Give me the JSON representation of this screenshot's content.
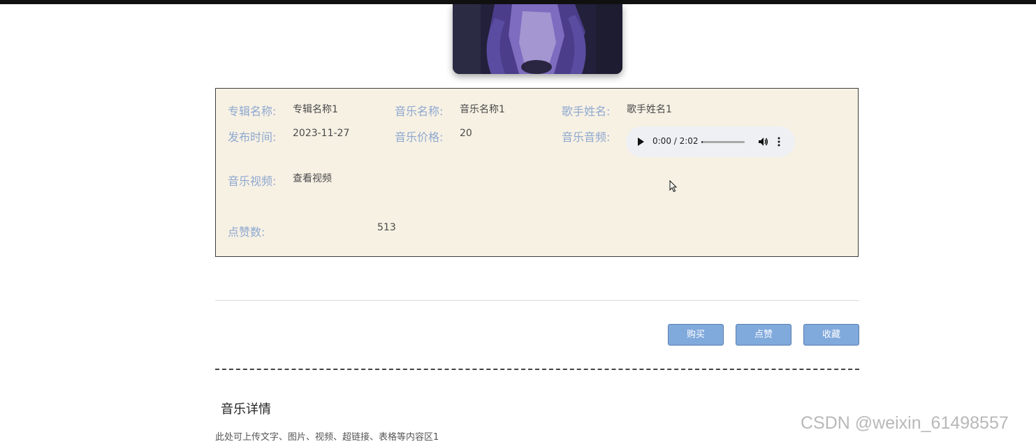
{
  "cover": {
    "alt_icon": "album-cover-image"
  },
  "info": {
    "album_label": "专辑名称:",
    "album_value": "专辑名称1",
    "music_name_label": "音乐名称:",
    "music_name_value": "音乐名称1",
    "singer_label": "歌手姓名:",
    "singer_value": "歌手姓名1",
    "release_label": "发布时间:",
    "release_value": "2023-11-27",
    "price_label": "音乐价格:",
    "price_value": "20",
    "audio_label": "音乐音频:",
    "audio_time": "0:00 / 2:02",
    "video_label": "音乐视频:",
    "video_link": "查看视频",
    "likes_label": "点赞数:",
    "likes_value": "513"
  },
  "audio": {
    "progress": 0.0
  },
  "actions": {
    "buy": "购买",
    "like": "点赞",
    "favorite": "收藏"
  },
  "detail": {
    "title": "音乐详情",
    "content": "此处可上传文字、图片、视频、超链接、表格等内容区1"
  },
  "watermark": "CSDN @weixin_61498557",
  "colors": {
    "label": "#8ea8cf",
    "box_bg": "#f7f1e4",
    "button_bg": "#80a9dc"
  }
}
